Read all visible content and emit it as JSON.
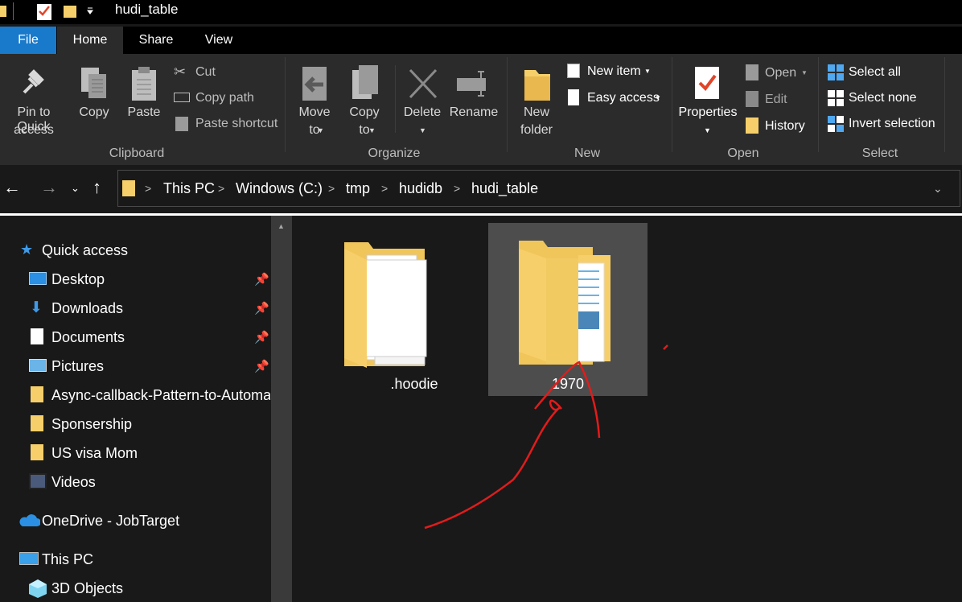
{
  "window": {
    "title": "hudi_table"
  },
  "tabs": [
    "File",
    "Home",
    "Share",
    "View"
  ],
  "ribbon": {
    "clipboard": {
      "pin_line1": "Pin to Quick",
      "pin_line2": "access",
      "copy": "Copy",
      "paste": "Paste",
      "cut": "Cut",
      "copy_path": "Copy path",
      "paste_shortcut": "Paste shortcut",
      "group": "Clipboard"
    },
    "organize": {
      "move_line1": "Move",
      "move_line2": "to",
      "copy_line1": "Copy",
      "copy_line2": "to",
      "delete": "Delete",
      "rename": "Rename",
      "group": "Organize"
    },
    "new": {
      "new_folder_line1": "New",
      "new_folder_line2": "folder",
      "new_item": "New item",
      "easy_access": "Easy access",
      "group": "New"
    },
    "open": {
      "properties": "Properties",
      "open": "Open",
      "edit": "Edit",
      "history": "History",
      "group": "Open"
    },
    "select": {
      "select_all": "Select all",
      "select_none": "Select none",
      "invert": "Invert selection",
      "group": "Select"
    }
  },
  "breadcrumb": [
    "This PC",
    "Windows (C:)",
    "tmp",
    "hudidb",
    "hudi_table"
  ],
  "nav": {
    "quick_access": "Quick access",
    "items": [
      "Desktop",
      "Downloads",
      "Documents",
      "Pictures",
      "Async-callback-Pattern-to-Automa",
      "Sponsership",
      "US visa Mom",
      "Videos"
    ],
    "onedrive": "OneDrive - JobTarget",
    "this_pc": "This PC",
    "objects3d": "3D Objects"
  },
  "files": [
    ".hoodie",
    "1970"
  ],
  "colors": {
    "accent": "#1979ca",
    "folder": "#f7cf6a",
    "annotation": "#e31b1b"
  }
}
